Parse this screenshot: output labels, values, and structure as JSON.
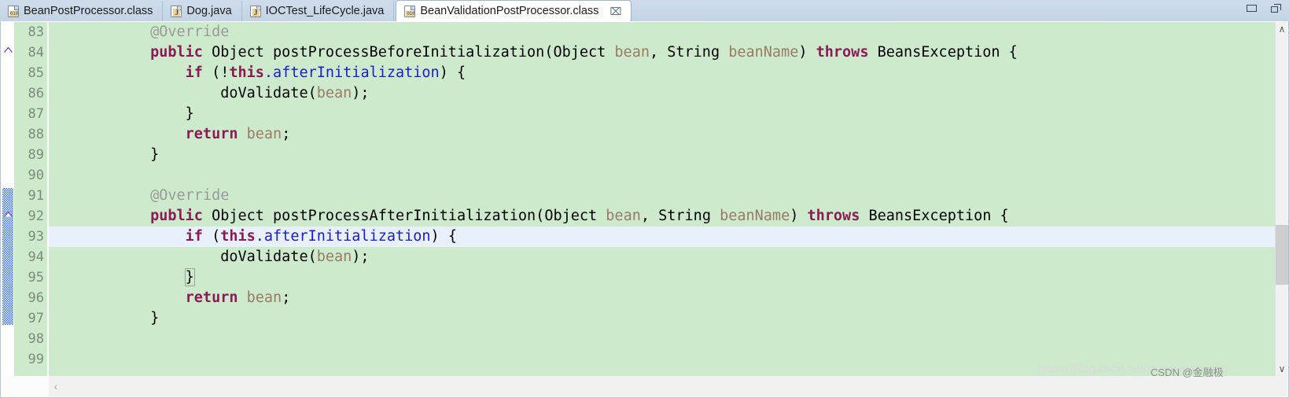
{
  "window": {
    "minimize_label": "Minimize",
    "maximize_label": "Maximize"
  },
  "tabs": [
    {
      "label": "BeanPostProcessor.class",
      "icon": "class-file-icon",
      "active": false,
      "closable": false
    },
    {
      "label": "Dog.java",
      "icon": "java-file-icon",
      "active": false,
      "closable": false
    },
    {
      "label": "IOCTest_LifeCycle.java",
      "icon": "java-file-icon",
      "active": false,
      "closable": false
    },
    {
      "label": "BeanValidationPostProcessor.class",
      "icon": "class-file-icon",
      "active": true,
      "closable": true,
      "close_glyph": "⌧"
    }
  ],
  "editor": {
    "first_line": 83,
    "current_line": 93,
    "line_numbers": [
      "83",
      "84",
      "85",
      "86",
      "87",
      "88",
      "89",
      "90",
      "91",
      "92",
      "93",
      "94",
      "95",
      "96",
      "97",
      "98",
      "99"
    ],
    "fold_markers": [
      83,
      91
    ],
    "lines": [
      {
        "n": 83,
        "tokens": [
          {
            "t": "        ",
            "c": "plain"
          },
          {
            "t": "@Override",
            "c": "anno"
          }
        ]
      },
      {
        "n": 84,
        "tokens": [
          {
            "t": "        ",
            "c": "plain"
          },
          {
            "t": "public",
            "c": "kw"
          },
          {
            "t": " Object postProcessBeforeInitialization(Object ",
            "c": "plain"
          },
          {
            "t": "bean",
            "c": "param"
          },
          {
            "t": ", String ",
            "c": "plain"
          },
          {
            "t": "beanName",
            "c": "param"
          },
          {
            "t": ") ",
            "c": "plain"
          },
          {
            "t": "throws",
            "c": "kw"
          },
          {
            "t": " BeansException {",
            "c": "plain"
          }
        ]
      },
      {
        "n": 85,
        "tokens": [
          {
            "t": "            ",
            "c": "plain"
          },
          {
            "t": "if",
            "c": "kw"
          },
          {
            "t": " (!",
            "c": "plain"
          },
          {
            "t": "this",
            "c": "kw"
          },
          {
            "t": ".afterInitialization",
            "c": "field"
          },
          {
            "t": ") {",
            "c": "plain"
          }
        ]
      },
      {
        "n": 86,
        "tokens": [
          {
            "t": "                doValidate(",
            "c": "plain"
          },
          {
            "t": "bean",
            "c": "param"
          },
          {
            "t": ");",
            "c": "plain"
          }
        ]
      },
      {
        "n": 87,
        "tokens": [
          {
            "t": "            }",
            "c": "plain"
          }
        ]
      },
      {
        "n": 88,
        "tokens": [
          {
            "t": "            ",
            "c": "plain"
          },
          {
            "t": "return",
            "c": "kw"
          },
          {
            "t": " ",
            "c": "plain"
          },
          {
            "t": "bean",
            "c": "param"
          },
          {
            "t": ";",
            "c": "plain"
          }
        ]
      },
      {
        "n": 89,
        "tokens": [
          {
            "t": "        }",
            "c": "plain"
          }
        ]
      },
      {
        "n": 90,
        "tokens": [
          {
            "t": "",
            "c": "plain"
          }
        ]
      },
      {
        "n": 91,
        "tokens": [
          {
            "t": "        ",
            "c": "plain"
          },
          {
            "t": "@Override",
            "c": "anno"
          }
        ]
      },
      {
        "n": 92,
        "tokens": [
          {
            "t": "        ",
            "c": "plain"
          },
          {
            "t": "public",
            "c": "kw"
          },
          {
            "t": " Object postProcessAfterInitialization(Object ",
            "c": "plain"
          },
          {
            "t": "bean",
            "c": "param"
          },
          {
            "t": ", String ",
            "c": "plain"
          },
          {
            "t": "beanName",
            "c": "param"
          },
          {
            "t": ") ",
            "c": "plain"
          },
          {
            "t": "throws",
            "c": "kw"
          },
          {
            "t": " BeansException {",
            "c": "plain"
          }
        ]
      },
      {
        "n": 93,
        "tokens": [
          {
            "t": "            ",
            "c": "plain"
          },
          {
            "t": "if",
            "c": "kw"
          },
          {
            "t": " (",
            "c": "plain"
          },
          {
            "t": "this",
            "c": "kw"
          },
          {
            "t": ".afterInitialization",
            "c": "field"
          },
          {
            "t": ") {",
            "c": "plain"
          }
        ]
      },
      {
        "n": 94,
        "tokens": [
          {
            "t": "                doValidate(",
            "c": "plain"
          },
          {
            "t": "bean",
            "c": "param"
          },
          {
            "t": ");",
            "c": "plain"
          }
        ]
      },
      {
        "n": 95,
        "tokens": [
          {
            "t": "            ",
            "c": "plain"
          },
          {
            "t": "}",
            "c": "brace"
          }
        ]
      },
      {
        "n": 96,
        "tokens": [
          {
            "t": "            ",
            "c": "plain"
          },
          {
            "t": "return",
            "c": "kw"
          },
          {
            "t": " ",
            "c": "plain"
          },
          {
            "t": "bean",
            "c": "param"
          },
          {
            "t": ";",
            "c": "plain"
          }
        ]
      },
      {
        "n": 97,
        "tokens": [
          {
            "t": "        }",
            "c": "plain"
          }
        ]
      },
      {
        "n": 98,
        "tokens": [
          {
            "t": "",
            "c": "plain"
          }
        ]
      },
      {
        "n": 99,
        "tokens": [
          {
            "t": "",
            "c": "plain"
          }
        ]
      }
    ]
  },
  "scrollbars": {
    "vertical": {
      "up_glyph": "∧",
      "down_glyph": "∨"
    },
    "horizontal": {
      "left_glyph": "‹"
    }
  },
  "watermark": {
    "url": "https://blog.csdn.net/yerenyuan_pku",
    "credit": "CSDN @金融极"
  },
  "colors": {
    "editor_background": "#cdeacd",
    "current_line": "#e8f0fb",
    "tabbar": "#c9d8e8",
    "keyword": "#8b1a55",
    "annotation": "#9a9a9a",
    "parameter": "#9a7b62",
    "field": "#1c1ccf",
    "line_number": "#7d8a7d",
    "annotation_band": "#2d6fd4"
  }
}
